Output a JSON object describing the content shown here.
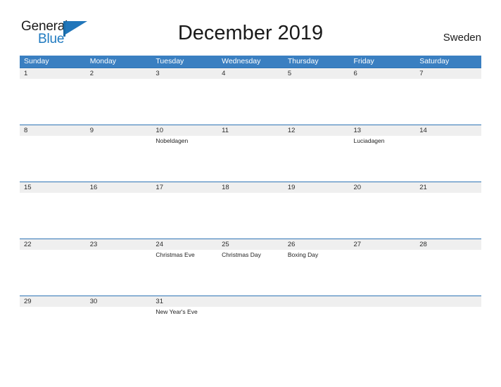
{
  "brand": {
    "word_one": "General",
    "word_two": "Blue",
    "flag_icon": "pennant-flag-icon",
    "accent_color": "#2176ba"
  },
  "header": {
    "title": "December 2019",
    "region": "Sweden"
  },
  "colors": {
    "header_blue": "#3a7fc1",
    "row_rule_blue": "#2e74b5",
    "band_gray": "#efefef",
    "text_dark": "#1a1a1a"
  },
  "calendar": {
    "month": "December",
    "year": "2019",
    "weekdays": [
      {
        "label": "Sunday"
      },
      {
        "label": "Monday"
      },
      {
        "label": "Tuesday"
      },
      {
        "label": "Wednesday"
      },
      {
        "label": "Thursday"
      },
      {
        "label": "Friday"
      },
      {
        "label": "Saturday"
      }
    ],
    "weeks": [
      {
        "days": [
          {
            "num": "1",
            "event": ""
          },
          {
            "num": "2",
            "event": ""
          },
          {
            "num": "3",
            "event": ""
          },
          {
            "num": "4",
            "event": ""
          },
          {
            "num": "5",
            "event": ""
          },
          {
            "num": "6",
            "event": ""
          },
          {
            "num": "7",
            "event": ""
          }
        ]
      },
      {
        "days": [
          {
            "num": "8",
            "event": ""
          },
          {
            "num": "9",
            "event": ""
          },
          {
            "num": "10",
            "event": "Nobeldagen"
          },
          {
            "num": "11",
            "event": ""
          },
          {
            "num": "12",
            "event": ""
          },
          {
            "num": "13",
            "event": "Luciadagen"
          },
          {
            "num": "14",
            "event": ""
          }
        ]
      },
      {
        "days": [
          {
            "num": "15",
            "event": ""
          },
          {
            "num": "16",
            "event": ""
          },
          {
            "num": "17",
            "event": ""
          },
          {
            "num": "18",
            "event": ""
          },
          {
            "num": "19",
            "event": ""
          },
          {
            "num": "20",
            "event": ""
          },
          {
            "num": "21",
            "event": ""
          }
        ]
      },
      {
        "days": [
          {
            "num": "22",
            "event": ""
          },
          {
            "num": "23",
            "event": ""
          },
          {
            "num": "24",
            "event": "Christmas Eve"
          },
          {
            "num": "25",
            "event": "Christmas Day"
          },
          {
            "num": "26",
            "event": "Boxing Day"
          },
          {
            "num": "27",
            "event": ""
          },
          {
            "num": "28",
            "event": ""
          }
        ]
      },
      {
        "days": [
          {
            "num": "29",
            "event": ""
          },
          {
            "num": "30",
            "event": ""
          },
          {
            "num": "31",
            "event": "New Year's Eve"
          },
          {
            "num": "",
            "event": ""
          },
          {
            "num": "",
            "event": ""
          },
          {
            "num": "",
            "event": ""
          },
          {
            "num": "",
            "event": ""
          }
        ]
      }
    ]
  }
}
